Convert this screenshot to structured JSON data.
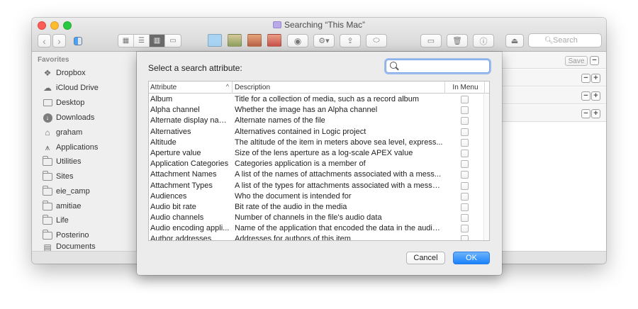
{
  "window": {
    "title": "Searching “This Mac”",
    "search_placeholder": "Search"
  },
  "sidebar": {
    "header": "Favorites",
    "items": [
      {
        "label": "Dropbox",
        "icon": "dropbox-icon"
      },
      {
        "label": "iCloud Drive",
        "icon": "cloud-icon"
      },
      {
        "label": "Desktop",
        "icon": "desktop-icon"
      },
      {
        "label": "Downloads",
        "icon": "download-icon"
      },
      {
        "label": "graham",
        "icon": "home-icon"
      },
      {
        "label": "Applications",
        "icon": "applications-icon"
      },
      {
        "label": "Utilities",
        "icon": "folder-icon"
      },
      {
        "label": "Sites",
        "icon": "folder-icon"
      },
      {
        "label": "eie_camp",
        "icon": "folder-icon"
      },
      {
        "label": "amitiae",
        "icon": "folder-icon"
      },
      {
        "label": "Life",
        "icon": "folder-icon"
      },
      {
        "label": "Posterino",
        "icon": "folder-icon"
      },
      {
        "label": "Documents",
        "icon": "documents-icon"
      }
    ]
  },
  "content": {
    "save_label": "Save",
    "minus": "−",
    "plus": "+"
  },
  "dialog": {
    "prompt": "Select a search attribute:",
    "search_value": "",
    "columns": {
      "attribute": "Attribute",
      "description": "Description",
      "in_menu": "In Menu"
    },
    "rows": [
      {
        "attribute": "Album",
        "description": "Title for a collection of media, such as a record album",
        "in_menu": false
      },
      {
        "attribute": "Alpha channel",
        "description": "Whether the image has an Alpha channel",
        "in_menu": false
      },
      {
        "attribute": "Alternate display nam...",
        "description": "Alternate names of the file",
        "in_menu": false
      },
      {
        "attribute": "Alternatives",
        "description": "Alternatives contained in Logic project",
        "in_menu": false
      },
      {
        "attribute": "Altitude",
        "description": "The altitude of the item in meters above sea level, express...",
        "in_menu": false
      },
      {
        "attribute": "Aperture value",
        "description": "Size of the lens aperture as a log-scale APEX value",
        "in_menu": false
      },
      {
        "attribute": "Application Categories",
        "description": "Categories application is a member of",
        "in_menu": false
      },
      {
        "attribute": "Attachment Names",
        "description": "A list of the names of attachments associated with a mess...",
        "in_menu": false
      },
      {
        "attribute": "Attachment Types",
        "description": "A list of the types for attachments associated with a messa...",
        "in_menu": false
      },
      {
        "attribute": "Audiences",
        "description": "Who the document is intended for",
        "in_menu": false
      },
      {
        "attribute": "Audio bit rate",
        "description": "Bit rate of the audio in the media",
        "in_menu": false
      },
      {
        "attribute": "Audio channels",
        "description": "Number of channels in the file's audio data",
        "in_menu": false
      },
      {
        "attribute": "Audio encoding appli...",
        "description": "Name of the application that encoded the data in the audio...",
        "in_menu": false
      },
      {
        "attribute": "Author addresses",
        "description": "Addresses for authors of this item",
        "in_menu": false
      }
    ],
    "cancel_label": "Cancel",
    "ok_label": "OK"
  }
}
